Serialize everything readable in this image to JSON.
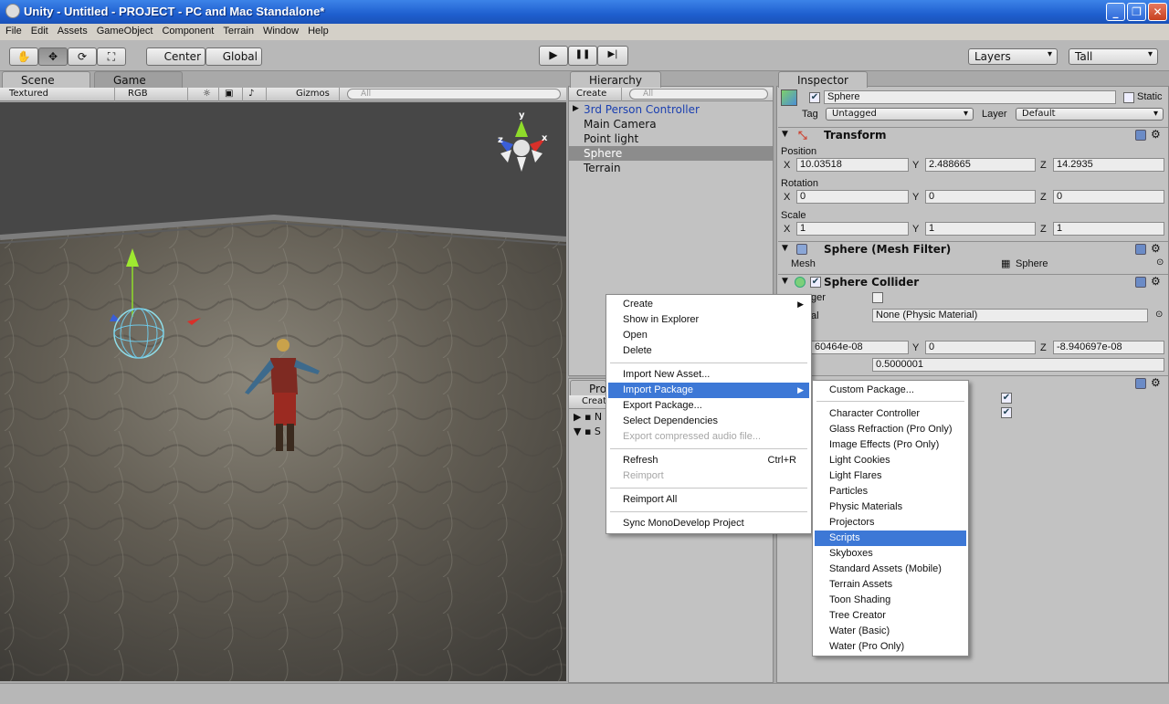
{
  "window": {
    "title": "Unity - Untitled - PROJECT - PC and Mac Standalone*",
    "minimize": "_",
    "maximize": "❐",
    "close": "✕"
  },
  "menubar": [
    "File",
    "Edit",
    "Assets",
    "GameObject",
    "Component",
    "Terrain",
    "Window",
    "Help"
  ],
  "toolbar": {
    "tools": [
      "✋",
      "✥",
      "⟳",
      "⛶"
    ],
    "pivot": "Center",
    "space": "Global",
    "play": "▶",
    "pause": "❚❚",
    "step": "▶|",
    "layers": "Layers",
    "layout": "Tall"
  },
  "scene": {
    "tab": "Scene",
    "game_tab": "Game",
    "render_mode": "Textured",
    "color_mode": "RGB",
    "gizmos": "Gizmos",
    "search_placeholder": "All",
    "gizmo_axes": {
      "y": "y",
      "x": "x",
      "z": "z"
    }
  },
  "hierarchy": {
    "tab": "Hierarchy",
    "create": "Create",
    "search_placeholder": "All",
    "items": [
      "3rd Person Controller",
      "Main Camera",
      "Point light",
      "Sphere",
      "Terrain"
    ],
    "selected": "Sphere"
  },
  "project": {
    "tab": "Pro",
    "create": "Creat",
    "rows": [
      "N",
      "S"
    ]
  },
  "inspector": {
    "tab": "Inspector",
    "name": "Sphere",
    "static": "Static",
    "tag_label": "Tag",
    "tag": "Untagged",
    "layer_label": "Layer",
    "layer": "Default",
    "transform": {
      "title": "Transform",
      "position_label": "Position",
      "rotation_label": "Rotation",
      "scale_label": "Scale",
      "position": {
        "x": "10.03518",
        "y": "2.488665",
        "z": "14.2935"
      },
      "rotation": {
        "x": "0",
        "y": "0",
        "z": "0"
      },
      "scale": {
        "x": "1",
        "y": "1",
        "z": "1"
      }
    },
    "mesh_filter": {
      "title": "Sphere (Mesh Filter)",
      "mesh_label": "Mesh",
      "mesh": "Sphere"
    },
    "sphere_collider": {
      "title": "Sphere Collider",
      "trigger_label": "ger",
      "material_label": "al",
      "material": "None (Physic Material)",
      "center_x": "60464e-08",
      "center_y": "0",
      "center_z": "-8.940697e-08",
      "radius": "0.5000001"
    }
  },
  "context_menu": {
    "items": [
      {
        "label": "Create",
        "submenu": true
      },
      {
        "label": "Show in Explorer"
      },
      {
        "label": "Open"
      },
      {
        "label": "Delete"
      },
      {
        "label": "Import New Asset..."
      },
      {
        "label": "Import Package",
        "submenu": true,
        "highlighted": true
      },
      {
        "label": "Export Package..."
      },
      {
        "label": "Select Dependencies"
      },
      {
        "label": "Export compressed audio file...",
        "disabled": true
      },
      {
        "label": "Refresh",
        "shortcut": "Ctrl+R"
      },
      {
        "label": "Reimport",
        "disabled": true
      },
      {
        "label": "Reimport All"
      },
      {
        "label": "Sync MonoDevelop Project"
      }
    ]
  },
  "import_submenu": {
    "items": [
      "Custom Package...",
      "Character Controller",
      "Glass Refraction (Pro Only)",
      "Image Effects (Pro Only)",
      "Light Cookies",
      "Light Flares",
      "Particles",
      "Physic Materials",
      "Projectors",
      "Scripts",
      "Skyboxes",
      "Standard Assets (Mobile)",
      "Terrain Assets",
      "Toon Shading",
      "Tree Creator",
      "Water (Basic)",
      "Water (Pro Only)"
    ],
    "highlighted": "Scripts"
  },
  "colors": {
    "accent": "#3d78d6",
    "titlebar": "#1f5fcf",
    "panel": "#c2c2c2"
  }
}
